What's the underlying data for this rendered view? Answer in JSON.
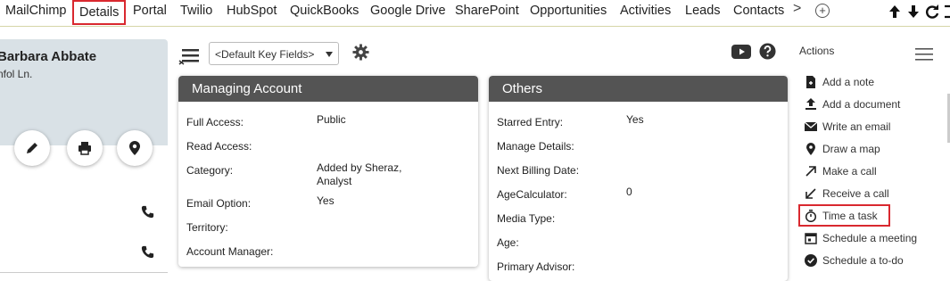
{
  "tabs": [
    {
      "label": "MailChimp",
      "active": false
    },
    {
      "label": "Details",
      "active": true
    },
    {
      "label": "Portal",
      "active": false
    },
    {
      "label": "Twilio",
      "active": false
    },
    {
      "label": "HubSpot",
      "active": false
    },
    {
      "label": "QuickBooks",
      "active": false
    },
    {
      "label": "Google Drive",
      "active": false
    },
    {
      "label": "SharePoint",
      "active": false
    },
    {
      "label": "Opportunities",
      "active": false
    },
    {
      "label": "Activities",
      "active": false
    },
    {
      "label": "Leads",
      "active": false
    },
    {
      "label": "Contacts",
      "active": false
    }
  ],
  "tabs_more": ">",
  "tabs_add": "+",
  "contact": {
    "name": "Barbara Abbate",
    "address": "nfol Ln."
  },
  "toolbar": {
    "field_select_value": "<Default Key Fields>"
  },
  "managing_account": {
    "title": "Managing Account",
    "fields": [
      {
        "label": "Full Access:",
        "value": "Public"
      },
      {
        "label": "Read Access:",
        "value": ""
      },
      {
        "label": "Category:",
        "value": "Added by Sheraz, Analyst"
      },
      {
        "label": "Email Option:",
        "value": "Yes"
      },
      {
        "label": "Territory:",
        "value": ""
      },
      {
        "label": "Account Manager:",
        "value": ""
      }
    ]
  },
  "others": {
    "title": "Others",
    "fields": [
      {
        "label": "Starred Entry:",
        "value": "Yes"
      },
      {
        "label": "Manage Details:",
        "value": ""
      },
      {
        "label": "Next Billing Date:",
        "value": ""
      },
      {
        "label": "AgeCalculator:",
        "value": "0"
      },
      {
        "label": "Media Type:",
        "value": ""
      },
      {
        "label": "Age:",
        "value": ""
      },
      {
        "label": "Primary Advisor:",
        "value": ""
      }
    ]
  },
  "actions": {
    "title": "Actions",
    "items": [
      {
        "label": "Add a note",
        "icon": "note-icon"
      },
      {
        "label": "Add a document",
        "icon": "upload-icon"
      },
      {
        "label": "Write an email",
        "icon": "email-icon"
      },
      {
        "label": "Draw a map",
        "icon": "map-pin-icon"
      },
      {
        "label": "Make a call",
        "icon": "outgoing-call-icon"
      },
      {
        "label": "Receive a call",
        "icon": "incoming-call-icon"
      },
      {
        "label": "Time a task",
        "icon": "stopwatch-icon",
        "highlighted": true
      },
      {
        "label": "Schedule a meeting",
        "icon": "calendar-icon"
      },
      {
        "label": "Schedule a to-do",
        "icon": "check-circle-icon"
      }
    ]
  },
  "colors": {
    "highlight": "#d9282f",
    "panel_header": "#545454",
    "contact_card": "#d9e1e6"
  }
}
